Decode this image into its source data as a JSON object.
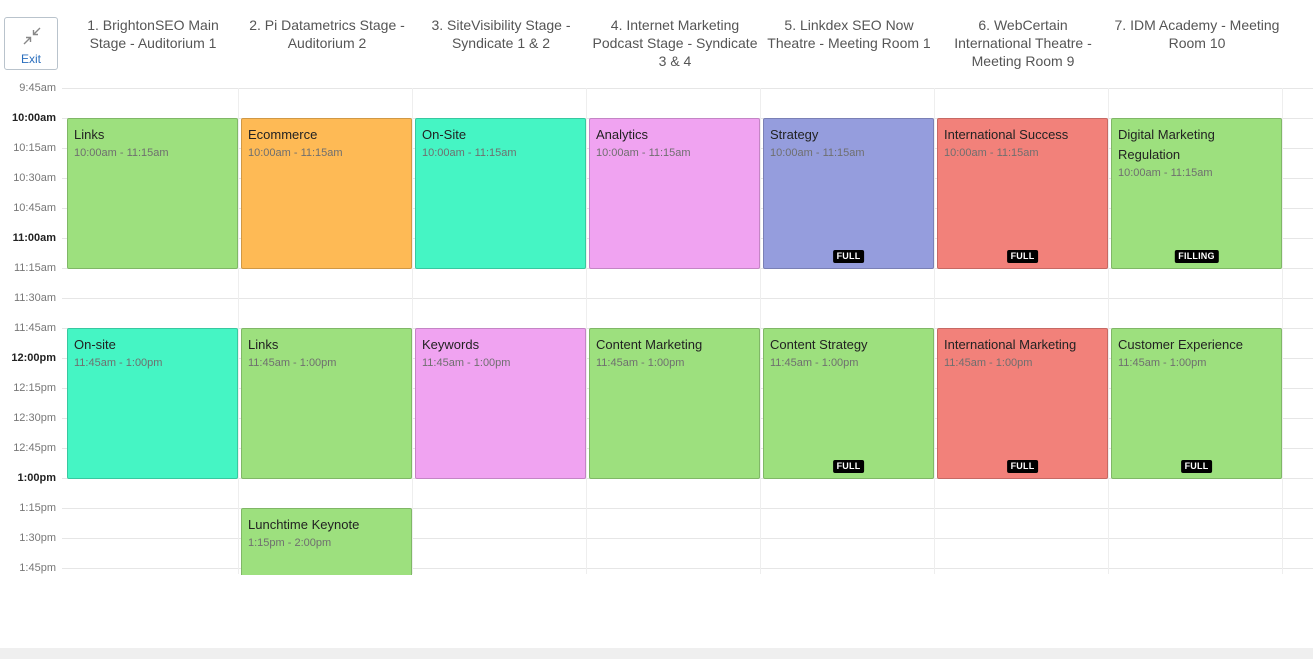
{
  "exit": {
    "label": "Exit"
  },
  "columns": [
    "1. BrightonSEO Main Stage - Auditorium 1",
    "2. Pi Datametrics Stage - Auditorium 2",
    "3. SiteVisibility Stage - Syndicate 1 & 2",
    "4. Internet Marketing Podcast Stage - Syndicate 3 & 4",
    "5. Linkdex SEO Now Theatre - Meeting Room 1",
    "6. WebCertain International Theatre - Meeting Room 9",
    "7. IDM Academy - Meeting Room 10"
  ],
  "times": [
    "9:45am",
    "10:00am",
    "10:15am",
    "10:30am",
    "10:45am",
    "11:00am",
    "11:15am",
    "11:30am",
    "11:45am",
    "12:00pm",
    "12:15pm",
    "12:30pm",
    "12:45pm",
    "1:00pm",
    "1:15pm",
    "1:30pm",
    "1:45pm"
  ],
  "hour_marks": [
    "10:00am",
    "11:00am",
    "12:00pm",
    "1:00pm"
  ],
  "colors": {
    "green": "#9de07e",
    "orange": "#feba55",
    "teal": "#45f5c4",
    "pink": "#f0a3f1",
    "purple": "#959ddd",
    "red": "#f2817a"
  },
  "sessions": [
    {
      "col": 0,
      "start": 1,
      "end": 6,
      "title": "Links",
      "time": "10:00am - 11:15am",
      "color": "green",
      "badge": ""
    },
    {
      "col": 1,
      "start": 1,
      "end": 6,
      "title": "Ecommerce",
      "time": "10:00am - 11:15am",
      "color": "orange",
      "badge": ""
    },
    {
      "col": 2,
      "start": 1,
      "end": 6,
      "title": "On-Site",
      "time": "10:00am - 11:15am",
      "color": "teal",
      "badge": ""
    },
    {
      "col": 3,
      "start": 1,
      "end": 6,
      "title": "Analytics",
      "time": "10:00am - 11:15am",
      "color": "pink",
      "badge": ""
    },
    {
      "col": 4,
      "start": 1,
      "end": 6,
      "title": "Strategy",
      "time": "10:00am - 11:15am",
      "color": "purple",
      "badge": "FULL"
    },
    {
      "col": 5,
      "start": 1,
      "end": 6,
      "title": "International Success",
      "time": "10:00am - 11:15am",
      "color": "red",
      "badge": "FULL"
    },
    {
      "col": 6,
      "start": 1,
      "end": 6,
      "title": "Digital Marketing Regulation",
      "time": "10:00am - 11:15am",
      "color": "green",
      "badge": "FILLING"
    },
    {
      "col": 0,
      "start": 8,
      "end": 13,
      "title": "On-site",
      "time": "11:45am - 1:00pm",
      "color": "teal",
      "badge": ""
    },
    {
      "col": 1,
      "start": 8,
      "end": 13,
      "title": "Links",
      "time": "11:45am - 1:00pm",
      "color": "green",
      "badge": ""
    },
    {
      "col": 2,
      "start": 8,
      "end": 13,
      "title": "Keywords",
      "time": "11:45am - 1:00pm",
      "color": "pink",
      "badge": ""
    },
    {
      "col": 3,
      "start": 8,
      "end": 13,
      "title": "Content Marketing",
      "time": "11:45am - 1:00pm",
      "color": "green",
      "badge": ""
    },
    {
      "col": 4,
      "start": 8,
      "end": 13,
      "title": "Content Strategy",
      "time": "11:45am - 1:00pm",
      "color": "green",
      "badge": "FULL"
    },
    {
      "col": 5,
      "start": 8,
      "end": 13,
      "title": "International Marketing",
      "time": "11:45am - 1:00pm",
      "color": "red",
      "badge": "FULL"
    },
    {
      "col": 6,
      "start": 8,
      "end": 13,
      "title": "Customer Experience",
      "time": "11:45am - 1:00pm",
      "color": "green",
      "badge": "FULL"
    },
    {
      "col": 1,
      "start": 14,
      "end": 16.2,
      "title": "Lunchtime Keynote",
      "time": "1:15pm - 2:00pm",
      "color": "green",
      "badge": "",
      "cut": true
    }
  ]
}
